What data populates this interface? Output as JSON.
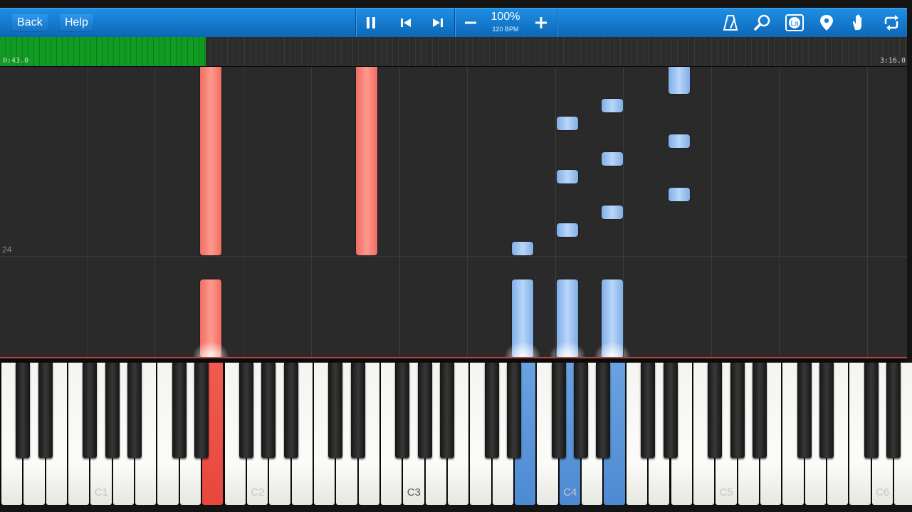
{
  "toolbar": {
    "back_label": "Back",
    "help_label": "Help",
    "speed_percent": "100%",
    "tempo": "120 BPM",
    "color": "#1a7fd4"
  },
  "progress": {
    "current_time": "0:43.0",
    "total_time": "3:16.0",
    "fraction": 0.227,
    "fill_color": "#119b22"
  },
  "roll": {
    "measure_number": "24"
  },
  "keyboard": {
    "octave_labels": [
      "C1",
      "C2",
      "C3",
      "C4",
      "C5",
      "C6"
    ],
    "pressed_left_hand_color": "#f05b50",
    "pressed_right_hand_color": "#6aa2e0"
  },
  "icons": [
    "pause-icon",
    "skip-back-icon",
    "skip-forward-icon",
    "minus-icon",
    "plus-icon",
    "metronome-icon",
    "magnifier-icon",
    "label-icon",
    "map-pin-icon",
    "hand-icon",
    "loop-icon"
  ]
}
